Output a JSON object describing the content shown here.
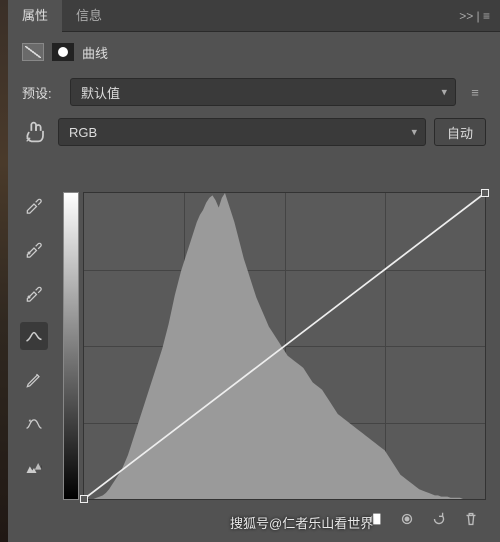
{
  "tabs": {
    "properties": "属性",
    "info": "信息",
    "collapse": ">> | ≡"
  },
  "subheader": {
    "title": "曲线"
  },
  "preset": {
    "label": "预设:",
    "value": "默认值"
  },
  "channel": {
    "value": "RGB",
    "auto_button": "自动"
  },
  "chart_data": {
    "type": "curves_histogram",
    "xlabel": "input",
    "ylabel": "output",
    "xlim": [
      0,
      255
    ],
    "ylim": [
      0,
      255
    ],
    "grid_divisions": 4,
    "curve_points": [
      {
        "x": 0,
        "y": 0
      },
      {
        "x": 255,
        "y": 255
      }
    ],
    "histogram_levels": [
      0,
      0,
      0,
      0,
      1,
      2,
      3,
      5,
      8,
      12,
      16,
      20,
      24,
      30,
      36,
      44,
      52,
      60,
      68,
      76,
      84,
      92,
      100,
      108,
      116,
      124,
      134,
      144,
      156,
      168,
      178,
      188,
      196,
      204,
      212,
      220,
      228,
      234,
      238,
      244,
      248,
      250,
      246,
      240,
      248,
      252,
      244,
      236,
      228,
      218,
      208,
      198,
      190,
      182,
      174,
      166,
      160,
      154,
      148,
      142,
      138,
      134,
      130,
      126,
      122,
      118,
      116,
      114,
      112,
      110,
      108,
      104,
      100,
      96,
      94,
      92,
      90,
      86,
      82,
      78,
      74,
      70,
      68,
      66,
      64,
      62,
      60,
      58,
      56,
      54,
      52,
      50,
      48,
      46,
      44,
      42,
      40,
      36,
      32,
      28,
      24,
      20,
      18,
      16,
      14,
      12,
      10,
      8,
      7,
      6,
      5,
      4,
      3,
      3,
      2,
      2,
      2,
      1,
      1,
      1,
      1,
      0,
      0,
      0,
      0,
      0,
      0,
      0
    ]
  },
  "watermark": "搜狐号@仁者乐山看世界"
}
